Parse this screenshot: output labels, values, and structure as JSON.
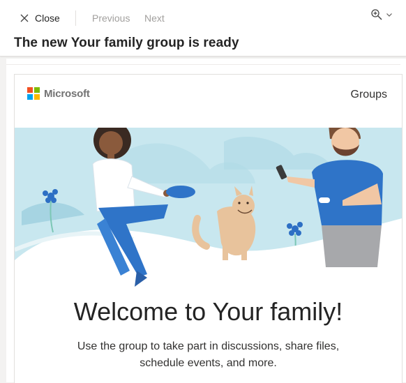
{
  "toolbar": {
    "close_label": "Close",
    "previous_label": "Previous",
    "next_label": "Next",
    "close_icon": "close-icon",
    "zoom_icon": "zoom-in-icon",
    "chevron_icon": "chevron-down-icon"
  },
  "subject": "The new Your family group is ready",
  "email": {
    "brand_name": "Microsoft",
    "logo_colors": [
      "#f25022",
      "#7fba00",
      "#00a4ef",
      "#ffb900"
    ],
    "header_right": "Groups",
    "heading": "Welcome to Your family!",
    "body": "Use the group to take part in discussions, share files, schedule events, and more."
  },
  "colors": {
    "accent_blue": "#2f74c8",
    "sky": "#c6e6ee",
    "disabled_text": "#a19f9d"
  }
}
